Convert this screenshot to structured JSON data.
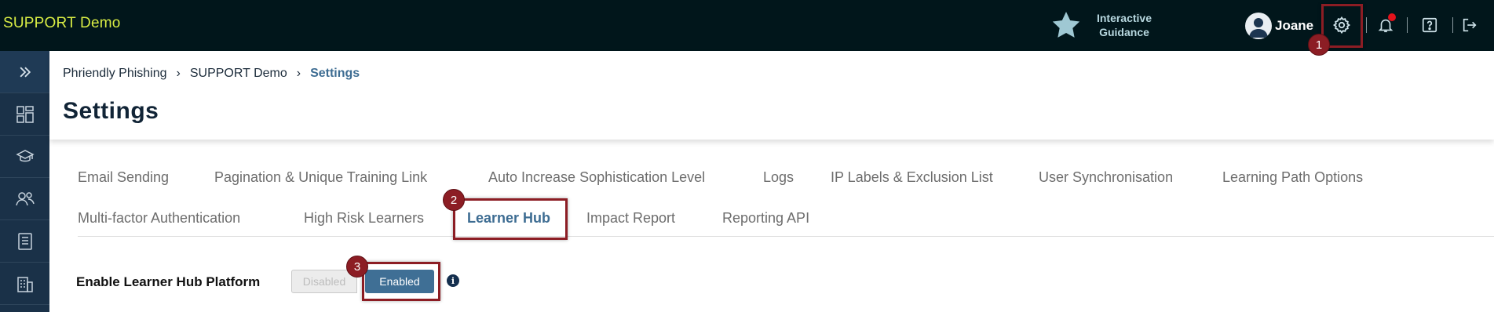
{
  "app": {
    "brand": "SUPPORT Demo"
  },
  "header": {
    "guidance_line1": "Interactive",
    "guidance_line2": "Guidance",
    "user_name": "Joane",
    "icons": [
      "star-icon",
      "settings-gear-icon",
      "bell-icon",
      "help-icon",
      "logout-icon"
    ]
  },
  "sidebar": {
    "items": [
      "expand-icon",
      "dashboard-icon",
      "training-icon",
      "users-icon",
      "book-icon",
      "building-icon"
    ]
  },
  "breadcrumb": [
    "Phriendly Phishing",
    "SUPPORT Demo",
    "Settings"
  ],
  "page": {
    "title": "Settings"
  },
  "tabs": [
    {
      "label": "Email Sending"
    },
    {
      "label": "Pagination & Unique Training Link"
    },
    {
      "label": "Auto Increase Sophistication Level"
    },
    {
      "label": "Logs"
    },
    {
      "label": "IP Labels & Exclusion List"
    },
    {
      "label": "User Synchronisation"
    },
    {
      "label": "Learning Path Options"
    },
    {
      "label": "Multi-factor Authentication"
    },
    {
      "label": "High Risk Learners"
    },
    {
      "label": "Learner Hub",
      "active": true
    },
    {
      "label": "Impact Report"
    },
    {
      "label": "Reporting API"
    }
  ],
  "learner_hub": {
    "label": "Enable Learner Hub Platform",
    "toggle_off": "Disabled",
    "toggle_on": "Enabled",
    "selected": "Enabled",
    "info_glyph": "i"
  },
  "annotations": {
    "steps": [
      "1",
      "2",
      "3"
    ]
  },
  "colors": {
    "topbar": "#01161b",
    "brand": "#d8ec44",
    "sidebar": "#1a3148",
    "accent": "#3d6c92",
    "highlight": "#8c1d24",
    "notification": "#e3121b"
  }
}
